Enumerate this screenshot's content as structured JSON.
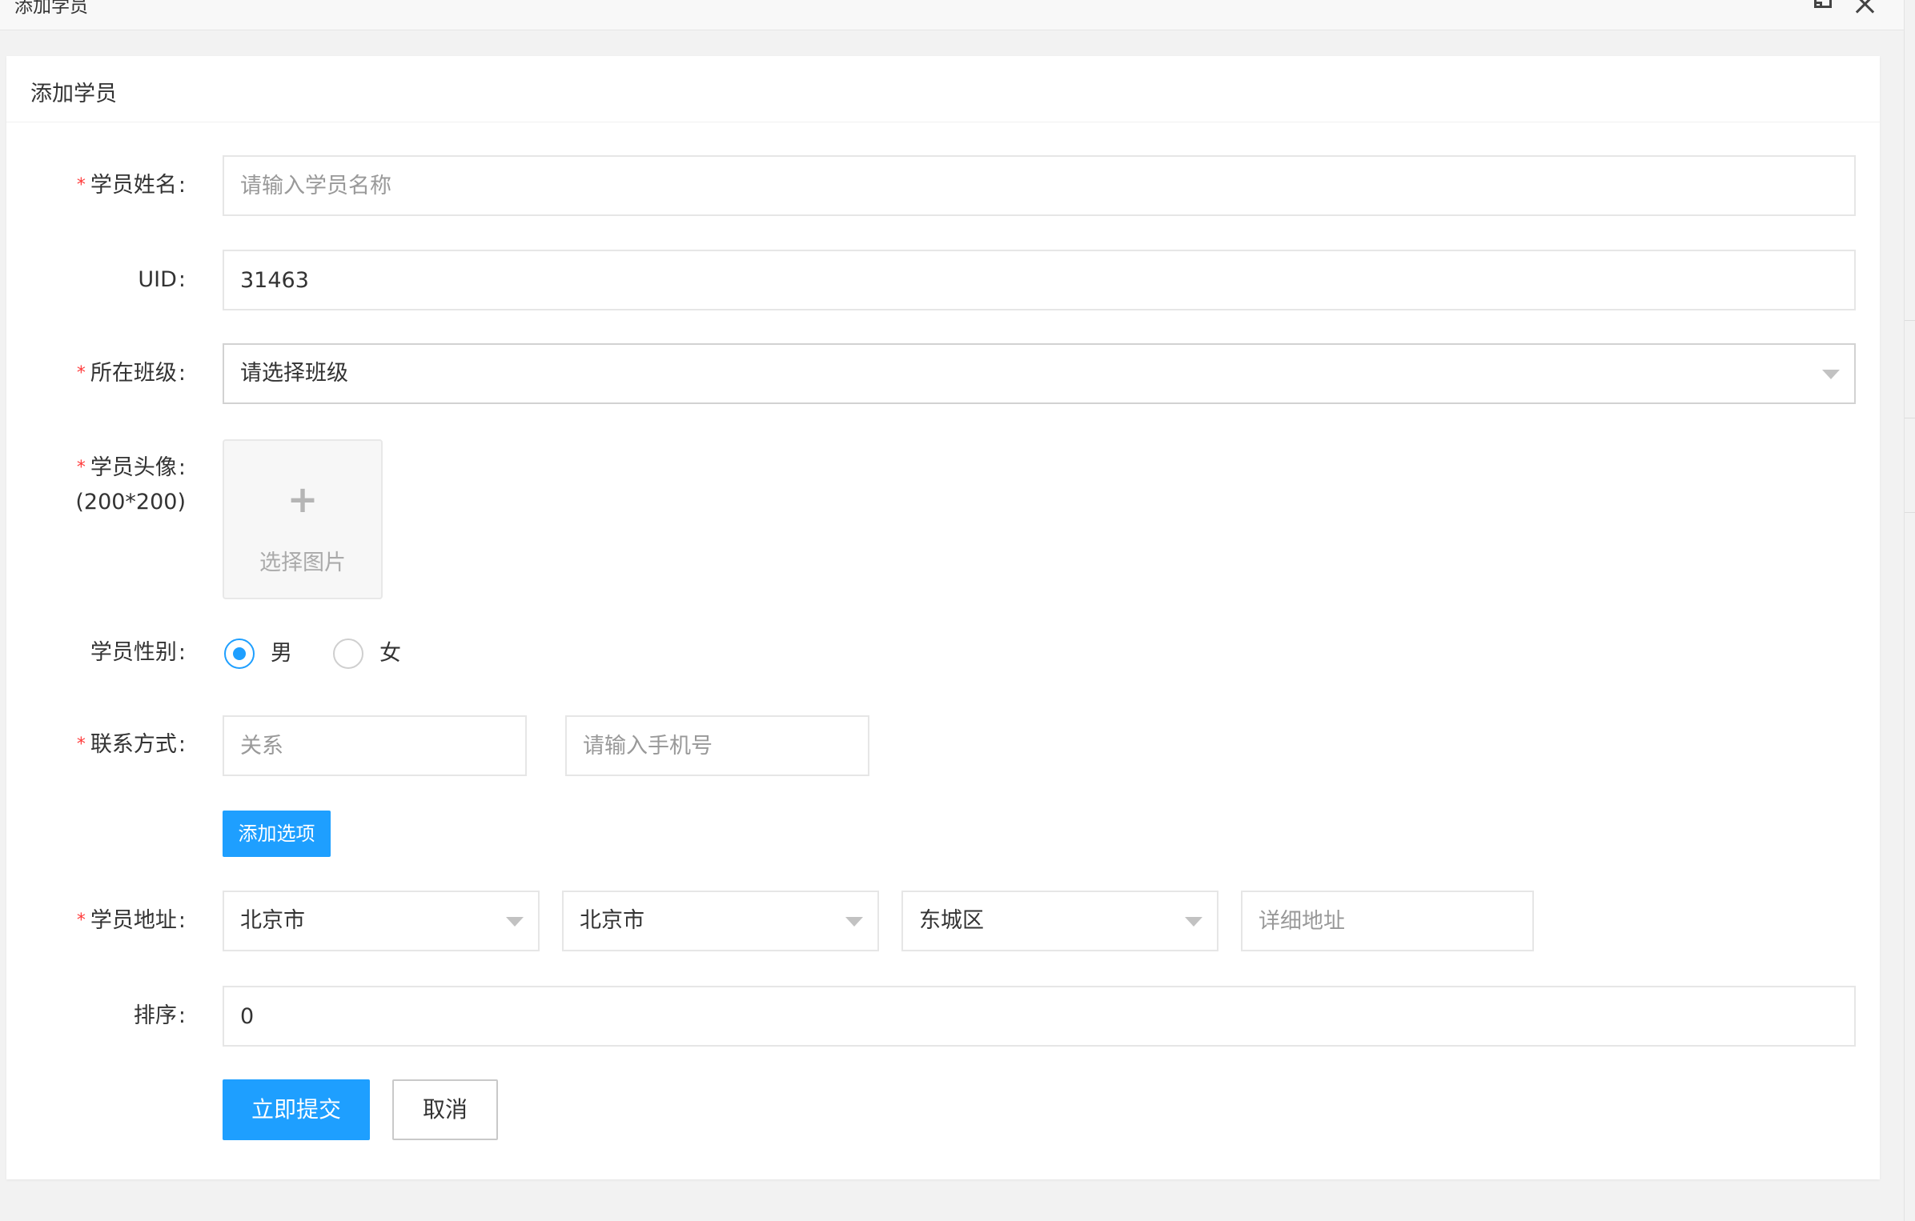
{
  "window": {
    "title": "添加学员"
  },
  "card": {
    "title": "添加学员"
  },
  "form": {
    "name": {
      "label": "学员姓名",
      "placeholder": "请输入学员名称",
      "value": ""
    },
    "uid": {
      "label": "UID",
      "value": "31463"
    },
    "class": {
      "label": "所在班级",
      "value": "请选择班级"
    },
    "avatar": {
      "label": "学员头像",
      "sublabel": "(200*200)",
      "button": "选择图片"
    },
    "gender": {
      "label": "学员性别",
      "options": [
        "男",
        "女"
      ],
      "selected": "男"
    },
    "contact": {
      "label": "联系方式",
      "relation_placeholder": "关系",
      "phone_placeholder": "请输入手机号",
      "add_button": "添加选项"
    },
    "address": {
      "label": "学员地址",
      "province": "北京市",
      "city": "北京市",
      "district": "东城区",
      "detail_placeholder": "详细地址"
    },
    "sort": {
      "label": "排序",
      "value": "0"
    },
    "submit_label": "立即提交",
    "cancel_label": "取消"
  },
  "colors": {
    "primary": "#1e9fff",
    "required": "#ff3d3d"
  }
}
